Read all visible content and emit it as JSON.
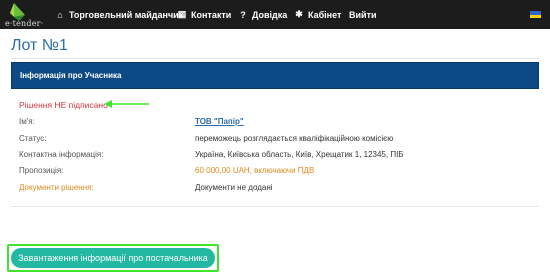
{
  "nav": {
    "logo_text": "e·tender·",
    "items": [
      {
        "label": "Торговельний майданчик",
        "icon": "home-icon"
      },
      {
        "label": "Контакти",
        "icon": "contacts-icon"
      },
      {
        "label": "Довідка",
        "icon": "help-icon"
      },
      {
        "label": "Кабінет",
        "icon": "cabinet-icon"
      },
      {
        "label": "Вийти",
        "icon": ""
      }
    ],
    "language_flag": "ukraine-flag-icon"
  },
  "page": {
    "title": "Лот №1"
  },
  "participant_panel": {
    "heading": "Інформація про Учасника"
  },
  "decision": {
    "status_text": "Рішення НЕ підписано"
  },
  "details": {
    "rows": [
      {
        "label": "Ім'я:",
        "value": "ТОВ \"Папір\""
      },
      {
        "label": "Статус:",
        "value": "переможець розглядається кваліфікаційною комісією"
      },
      {
        "label": "Контактна інформація:",
        "value": "Україна, Київська область, Київ, Хрещатик 1, 12345, ПІБ"
      },
      {
        "label": "Пропозиція:",
        "value": "60 000,00 UAH, включаючи ПДВ"
      },
      {
        "label": "Документи рішення:",
        "value": "Документи не додані"
      }
    ]
  },
  "actions": {
    "upload_label": "Завантаження інформації про постачальника"
  },
  "colors": {
    "navbar": "#1c1c1c",
    "title": "#2d6ca2",
    "panel": "#0b4a85",
    "danger": "#d9363e",
    "highlight": "#3fe52d",
    "button": "#23b8a1",
    "price": "#e08a1e"
  }
}
